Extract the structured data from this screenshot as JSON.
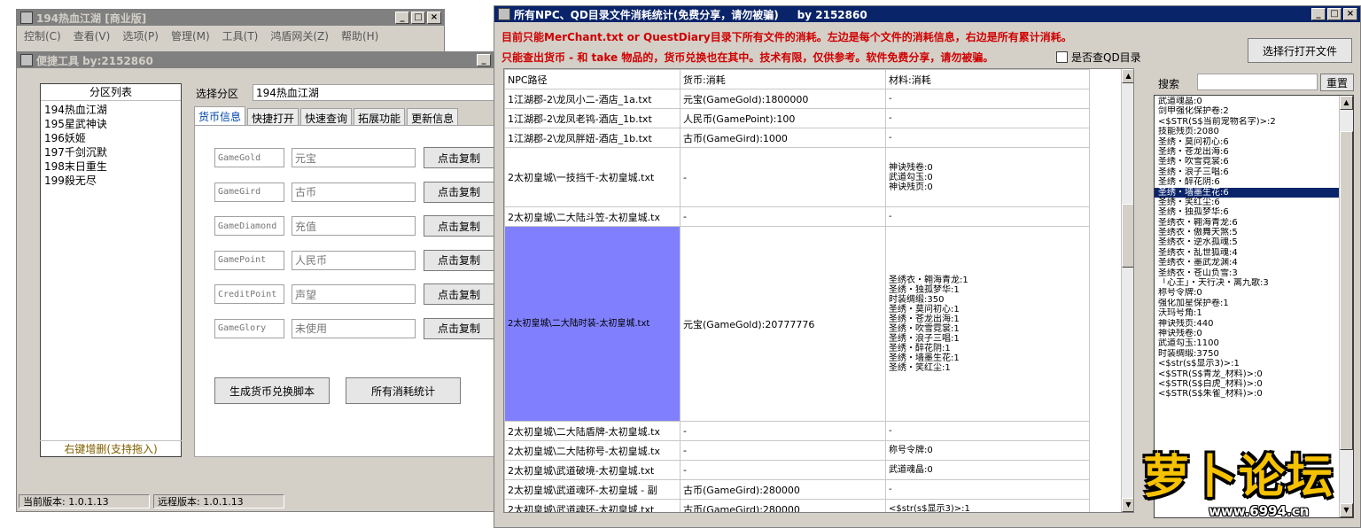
{
  "main_window": {
    "title": "194热血江湖 [商业版]",
    "menu": [
      "控制(C)",
      "查看(V)",
      "选项(P)",
      "管理(M)",
      "工具(T)",
      "鸿盾网关(Z)",
      "帮助(H)"
    ]
  },
  "quick_tool": {
    "title": "便捷工具  by:2152860",
    "partition_header": "分区列表",
    "partitions": [
      "194热血江湖",
      "195星武神诀",
      "196妖姬",
      "197千剑沉默",
      "198末日重生",
      "199殺无尽"
    ],
    "partition_footer": "右键增删(支持拖入)",
    "select_label": "选择分区",
    "select_value": "194热血江湖",
    "tabs": [
      "货币信息",
      "快捷打开",
      "快速查询",
      "拓展功能",
      "更新信息"
    ],
    "currencies": [
      {
        "key": "GameGold",
        "name": "元宝",
        "button": "点击复制"
      },
      {
        "key": "GameGird",
        "name": "古币",
        "button": "点击复制"
      },
      {
        "key": "GameDiamond",
        "name": "充值",
        "button": "点击复制"
      },
      {
        "key": "GamePoint",
        "name": "人民币",
        "button": "点击复制"
      },
      {
        "key": "CreditPoint",
        "name": "声望",
        "button": "点击复制"
      },
      {
        "key": "GameGlory",
        "name": "未使用",
        "button": "点击复制"
      }
    ],
    "gen_button": "生成货币兑换脚本",
    "stats_button": "所有消耗统计",
    "status_current": "当前版本: 1.0.1.13",
    "status_remote": "远程版本: 1.0.1.13"
  },
  "stats_window": {
    "title": "所有NPC、QD目录文件消耗统计(免费分享，请勿被骗)     by 2152860",
    "notice1": "目前只能MerChant.txt or QuestDiary目录下所有文件的消耗。左边是每个文件的消耗信息，右边是所有累计消耗。",
    "notice2": "只能查出货币 - 和 take 物品的，货币兑换也在其中。技术有限，仅供参考。软件免费分享，请勿被骗。",
    "checkbox_label": "是否查QD目录",
    "open_file_button": "选择行打开文件",
    "search_label": "搜索",
    "reset_button": "重置",
    "columns": [
      "NPC路径",
      "货币:消耗",
      "材料:消耗"
    ],
    "rows": [
      {
        "path": "1江湖郡-2\\龙凤小二-酒店_1a.txt",
        "currency": "元宝(GameGold):1800000",
        "material": "-"
      },
      {
        "path": "1江湖郡-2\\龙凤老鸨-酒店_1b.txt",
        "currency": "人民币(GamePoint):100",
        "material": "-"
      },
      {
        "path": "1江湖郡-2\\龙凤胖妞-酒店_1b.txt",
        "currency": "古币(GameGird):1000",
        "material": "-"
      },
      {
        "path": "2太初皇城\\一技挡千-太初皇城.txt",
        "currency": "-",
        "material": "神诀残卷:0\n武道勾玉:0\n神诀残页:0"
      },
      {
        "path": "2太初皇城\\二大陆斗笠-太初皇城.tx",
        "currency": "-",
        "material": "-"
      },
      {
        "path": "2太初皇城\\二大陆时装-太初皇城.txt",
        "currency": "元宝(GameGold):20777776",
        "material": "圣绣衣・翱海青龙:1\n圣绣・独孤梦华:1\n时装绸缎:350\n圣绣・莫问初心:1\n圣绣・苍龙出海:1\n圣绣・吹雪霓裳:1\n圣绣・浪子三唱:1\n圣绣・醉花阴:1\n圣绣・墙墨生花:1\n圣绣・笑红尘:1"
      },
      {
        "path": "2太初皇城\\二大陆盾牌-太初皇城.tx",
        "currency": "-",
        "material": "-"
      },
      {
        "path": "2太初皇城\\二大陆称号-太初皇城.tx",
        "currency": "-",
        "material": "称号令牌:0"
      },
      {
        "path": "2太初皇城\\武道破境-太初皇城.txt",
        "currency": "-",
        "material": "武道魂晶:0"
      },
      {
        "path": "2太初皇城\\武道魂环-太初皇城 - 副",
        "currency": "古币(GameGird):280000",
        "material": "-"
      },
      {
        "path": "2太初皇城\\武道魂环-太初皇城.txt",
        "currency": "古币(GameGird):280000",
        "material": "<$str(s$显示3)>:1"
      }
    ],
    "totals": [
      "武道魂晶:0",
      "剑甲强化保护卷:2",
      "<$STR(S$当前宠物名字)>:2",
      "技能残页:2080",
      "圣绣・莫问初心:6",
      "圣绣・苍龙出海:6",
      "圣绣・吹雪霓裳:6",
      "圣绣・浪子三唱:6",
      "圣绣・醉花阴:6",
      "圣绣・墙墨生花:6",
      "圣绣・笑红尘:6",
      "圣绣・独孤梦华:6",
      "圣绣衣・翱海青龙:6",
      "圣绣衣・傲舞天煞:5",
      "圣绣衣・逆水孤魂:5",
      "圣绣衣・乱世狐魂:4",
      "圣绣衣・墨武龙渊:4",
      "圣绣衣・苍山负雪:3",
      "「心王」・天行决・离九歌:3",
      "称号令牌:0",
      "强化加星保护卷:1",
      "沃玛号角:1",
      "神诀残页:440",
      "神诀残卷:0",
      "武道勾玉:1100",
      "时装绸缎:3750",
      "<$str(s$显示3)>:1",
      "<$STR(S$青龙_材料)>:0",
      "<$STR(S$白虎_材料)>:0",
      "<$STR(S$朱雀_材料)>:0"
    ],
    "selected_total_index": 9
  },
  "watermark": {
    "text": "萝卜论坛",
    "url": "www.6994.cn"
  },
  "colors": {
    "title_active": "#0a246a",
    "notice_red": "#d00000",
    "selected_cell": "#8080ff"
  }
}
